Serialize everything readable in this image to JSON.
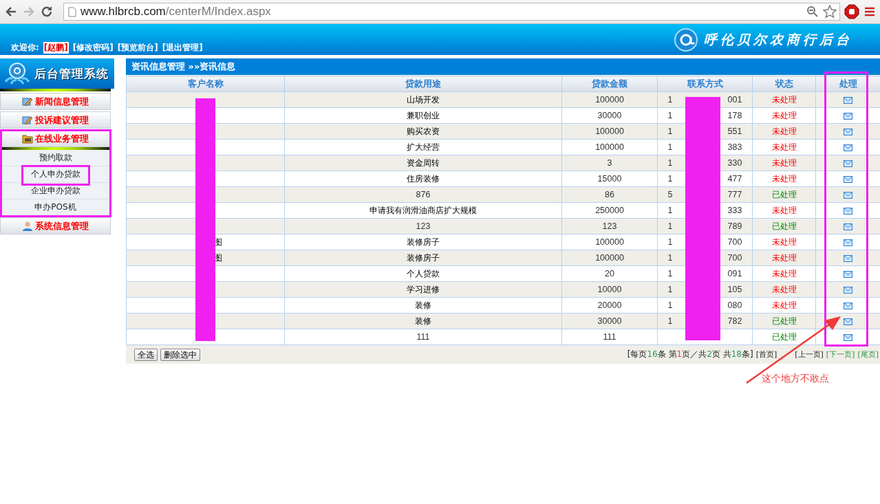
{
  "browser": {
    "url_host": "www.hlbrcb.com",
    "url_path": "/centerM/Index.aspx"
  },
  "header": {
    "welcome": "欢迎你:",
    "user": "[赵鹏]",
    "links": [
      "[修改密码]",
      "[预览前台]",
      "[退出管理]"
    ],
    "site_title": "呼伦贝尔农商行后台"
  },
  "sidebar": {
    "title": "后台管理系统",
    "menu": [
      {
        "label": "新闻信息管理",
        "kind": "doc",
        "expanded": false
      },
      {
        "label": "投诉建议管理",
        "kind": "doc",
        "expanded": false
      },
      {
        "label": "在线业务管理",
        "kind": "folder",
        "expanded": true,
        "children": [
          {
            "label": "预约取款"
          },
          {
            "label": "个人申办贷款"
          },
          {
            "label": "企业申办贷款"
          },
          {
            "label": "申办POS机"
          }
        ]
      },
      {
        "label": "系统信息管理",
        "kind": "user",
        "expanded": false
      }
    ]
  },
  "breadcrumb": "资讯信息管理 »»资讯信息",
  "table": {
    "columns": [
      "客户名称",
      "贷款用途",
      "贷款金额",
      "联系方式",
      "状态",
      "处理"
    ],
    "rows": [
      {
        "purpose": "山场开发",
        "amount": "100000",
        "contact_start": "1",
        "contact_end": "001",
        "status": "未处理",
        "processed": false
      },
      {
        "purpose": "兼职创业",
        "amount": "30000",
        "contact_start": "1",
        "contact_end": "178",
        "status": "未处理",
        "processed": false
      },
      {
        "purpose": "购买农资",
        "amount": "100000",
        "contact_start": "1",
        "contact_end": "551",
        "status": "未处理",
        "processed": false
      },
      {
        "purpose": "扩大经营",
        "amount": "100000",
        "contact_start": "1",
        "contact_end": "383",
        "status": "未处理",
        "processed": false
      },
      {
        "purpose": "资金周转",
        "amount": "3",
        "contact_start": "1",
        "contact_end": "330",
        "status": "未处理",
        "processed": false
      },
      {
        "purpose": "住房装修",
        "amount": "15000",
        "contact_start": "1",
        "contact_end": "477",
        "status": "未处理",
        "processed": false
      },
      {
        "purpose": "876",
        "amount": "86",
        "contact_start": "5",
        "contact_end": "777",
        "status": "已处理",
        "processed": true
      },
      {
        "purpose": "申请我有润滑油商店扩大规模",
        "amount": "250000",
        "contact_start": "1",
        "contact_end": "333",
        "status": "未处理",
        "processed": false
      },
      {
        "purpose": "123",
        "amount": "123",
        "contact_start": "1",
        "contact_end": "789",
        "status": "已处理",
        "processed": true
      },
      {
        "name_end": "图",
        "purpose": "装修房子",
        "amount": "100000",
        "contact_start": "1",
        "contact_end": "700",
        "status": "未处理",
        "processed": false
      },
      {
        "name_end": "图",
        "purpose": "装修房子",
        "amount": "100000",
        "contact_start": "1",
        "contact_end": "700",
        "status": "未处理",
        "processed": false
      },
      {
        "purpose": "个人贷款",
        "amount": "20",
        "contact_start": "1",
        "contact_end": "091",
        "status": "未处理",
        "processed": false
      },
      {
        "purpose": "学习进修",
        "amount": "10000",
        "contact_start": "1",
        "contact_end": "105",
        "status": "未处理",
        "processed": false
      },
      {
        "purpose": "装修",
        "amount": "20000",
        "contact_start": "1",
        "contact_end": "080",
        "status": "未处理",
        "processed": false
      },
      {
        "purpose": "装修",
        "amount": "30000",
        "contact_start": "1",
        "contact_end": "782",
        "status": "已处理",
        "processed": true
      },
      {
        "purpose": "111",
        "amount": "111",
        "status": "已处理",
        "processed": true
      }
    ]
  },
  "pager": {
    "buttons": [
      "全选",
      "删除选中"
    ],
    "summary": [
      {
        "text": "[每页"
      },
      {
        "text": "16",
        "color": "#2a9a5a"
      },
      {
        "text": "条 第"
      },
      {
        "text": "1",
        "color": "#f04040"
      },
      {
        "text": "页／共"
      },
      {
        "text": "2",
        "color": "#2a9a5a"
      },
      {
        "text": "页 共"
      },
      {
        "text": "18",
        "color": "#2a9a5a"
      },
      {
        "text": "条]"
      }
    ],
    "links": [
      {
        "label": "[首页]",
        "disabled": true
      },
      {
        "label": "[上一页]",
        "disabled": true
      },
      {
        "label": "[下一页]",
        "disabled": false
      },
      {
        "label": "[尾页]",
        "disabled": false
      }
    ]
  },
  "annotations": [
    {
      "kind": "highlight"
    },
    {
      "kind": "highlight"
    },
    {
      "kind": "highlight"
    },
    {
      "kind": "redaction"
    },
    {
      "kind": "redaction"
    },
    {
      "kind": "arrow"
    },
    {
      "kind": "note",
      "text": "这个地方不敢点"
    }
  ]
}
